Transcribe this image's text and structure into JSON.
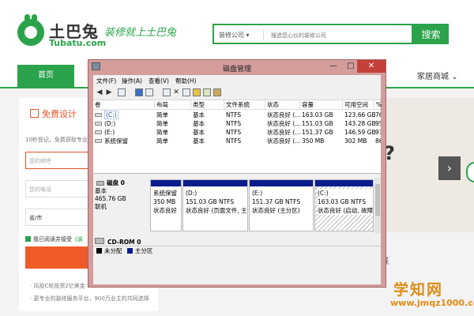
{
  "site": {
    "brand_cn": "土巴兔",
    "brand_en": "Tubatu.com",
    "slogan": "装修就上土巴兔",
    "search": {
      "category": "装修公司",
      "placeholder": "搜选您心仪的装修公司",
      "button": "搜索"
    },
    "nav": {
      "home": "首页",
      "mall": "家居商城"
    },
    "form": {
      "title": "免费设计",
      "subtitle": "10秒登记，免费获取专业",
      "name_placeholder": "您的称呼",
      "phone_placeholder": "您的电话",
      "city_value": "省/市",
      "agree_text": "我已阅读并接受",
      "agree_link": "《装",
      "submit": "立即",
      "note1": "· 风投C轮投资2亿美金",
      "note2": "· 更专业的装修服务平台，900万业主的共同选择"
    },
    "banner_char": "?",
    "banner_arrow": "›",
    "lower_right_text": "城"
  },
  "watermark": {
    "big": "学知网",
    "url": "www.jmqz1000.com"
  },
  "window": {
    "title": "磁盘管理",
    "controls": {
      "minimize": "—",
      "maximize": "□",
      "close": "✕"
    },
    "menus": [
      "文件(F)",
      "操作(A)",
      "查看(V)",
      "帮助(H)"
    ],
    "toolbar_icons": [
      "back-arrow-icon",
      "forward-arrow-icon",
      "list-view-icon",
      "help-icon",
      "disk-view-icon",
      "properties-icon",
      "delete-x-icon",
      "copy-icon",
      "folder-open-icon",
      "search-icon",
      "explore-icon"
    ],
    "table": {
      "columns": [
        "卷",
        "布局",
        "类型",
        "文件系统",
        "状态",
        "容量",
        "可用空间",
        "%"
      ],
      "rows": [
        {
          "name": "(C:)",
          "layout": "简单",
          "type": "基本",
          "fs": "NTFS",
          "status": "状态良好 (...",
          "capacity": "163.03 GB",
          "free": "123.66 GB",
          "pct": "76"
        },
        {
          "name": "(D:)",
          "layout": "简单",
          "type": "基本",
          "fs": "NTFS",
          "status": "状态良好 (...",
          "capacity": "151.03 GB",
          "free": "143.28 GB",
          "pct": "95"
        },
        {
          "name": "(E:)",
          "layout": "简单",
          "type": "基本",
          "fs": "NTFS",
          "status": "状态良好 (...",
          "capacity": "151.37 GB",
          "free": "146.59 GB",
          "pct": "97"
        },
        {
          "name": "系统保留",
          "layout": "简单",
          "type": "基本",
          "fs": "NTFS",
          "status": "状态良好 (...",
          "capacity": "350 MB",
          "free": "302 MB",
          "pct": "86"
        }
      ]
    },
    "disk0": {
      "label": "磁盘 0",
      "type": "基本",
      "size": "465.76 GB",
      "state": "联机",
      "partitions": [
        {
          "name": "系统保留",
          "size": "350 MB",
          "status": "状态良好"
        },
        {
          "name": "(D:)",
          "size": "151.03 GB NTFS",
          "status": "状态良好 (页面文件, 主"
        },
        {
          "name": "(E:)",
          "size": "151.37 GB NTFS",
          "status": "状态良好 (主分区)"
        },
        {
          "name": "(C:)",
          "size": "163.03 GB NTFS",
          "status": "状态良好 (启动, 故障转储"
        }
      ]
    },
    "cdrom": "CD-ROM 0",
    "legend": {
      "unallocated": "未分配",
      "primary": "主分区"
    },
    "colors": {
      "primary_partition": "#0b1d8c",
      "unallocated": "#000000",
      "title_bar": "#d39d9b"
    }
  }
}
